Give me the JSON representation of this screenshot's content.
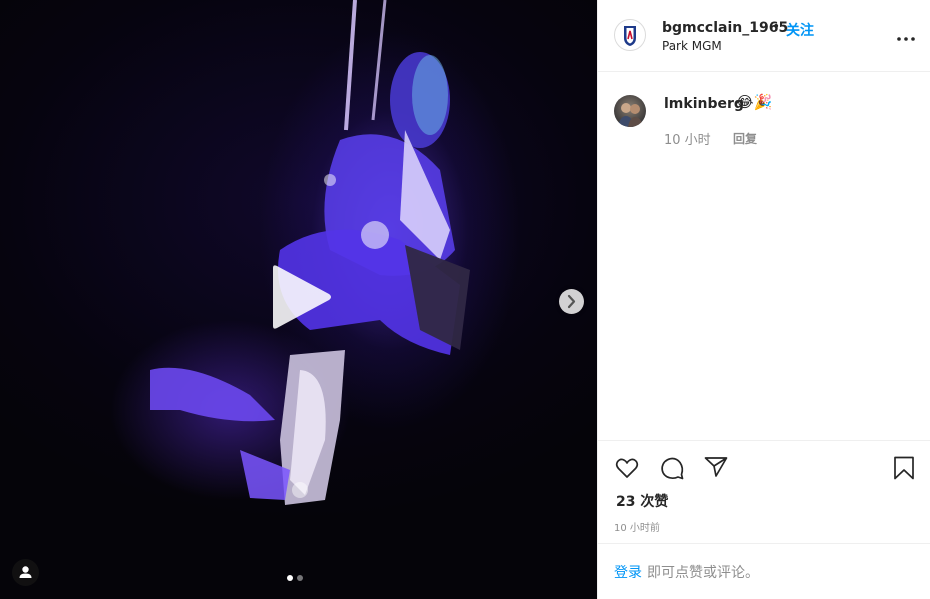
{
  "post": {
    "username": "bgmcclain_1965",
    "separator": "•",
    "follow_label": "关注",
    "location": "Park MGM",
    "more_icon": "more-horizontal-icon"
  },
  "media": {
    "play_icon": "play-icon",
    "next_icon": "chevron-right-icon",
    "tag_icon": "user-tag-icon",
    "carousel": {
      "total": 2,
      "current": 1
    }
  },
  "comments": [
    {
      "username": "lmkinberg",
      "text": "😂🎉",
      "time": "10 小时",
      "reply_label": "回复"
    }
  ],
  "actions": {
    "like_icon": "heart-icon",
    "comment_icon": "comment-icon",
    "share_icon": "send-icon",
    "save_icon": "bookmark-icon",
    "likes_text": "23 次赞",
    "timestamp": "10 小时前"
  },
  "login": {
    "link_label": "登录",
    "prompt": "即可点赞或评论。"
  },
  "colors": {
    "link_blue": "#0095f6",
    "text": "#262626",
    "muted": "#8e8e8e",
    "border": "#efefef"
  }
}
